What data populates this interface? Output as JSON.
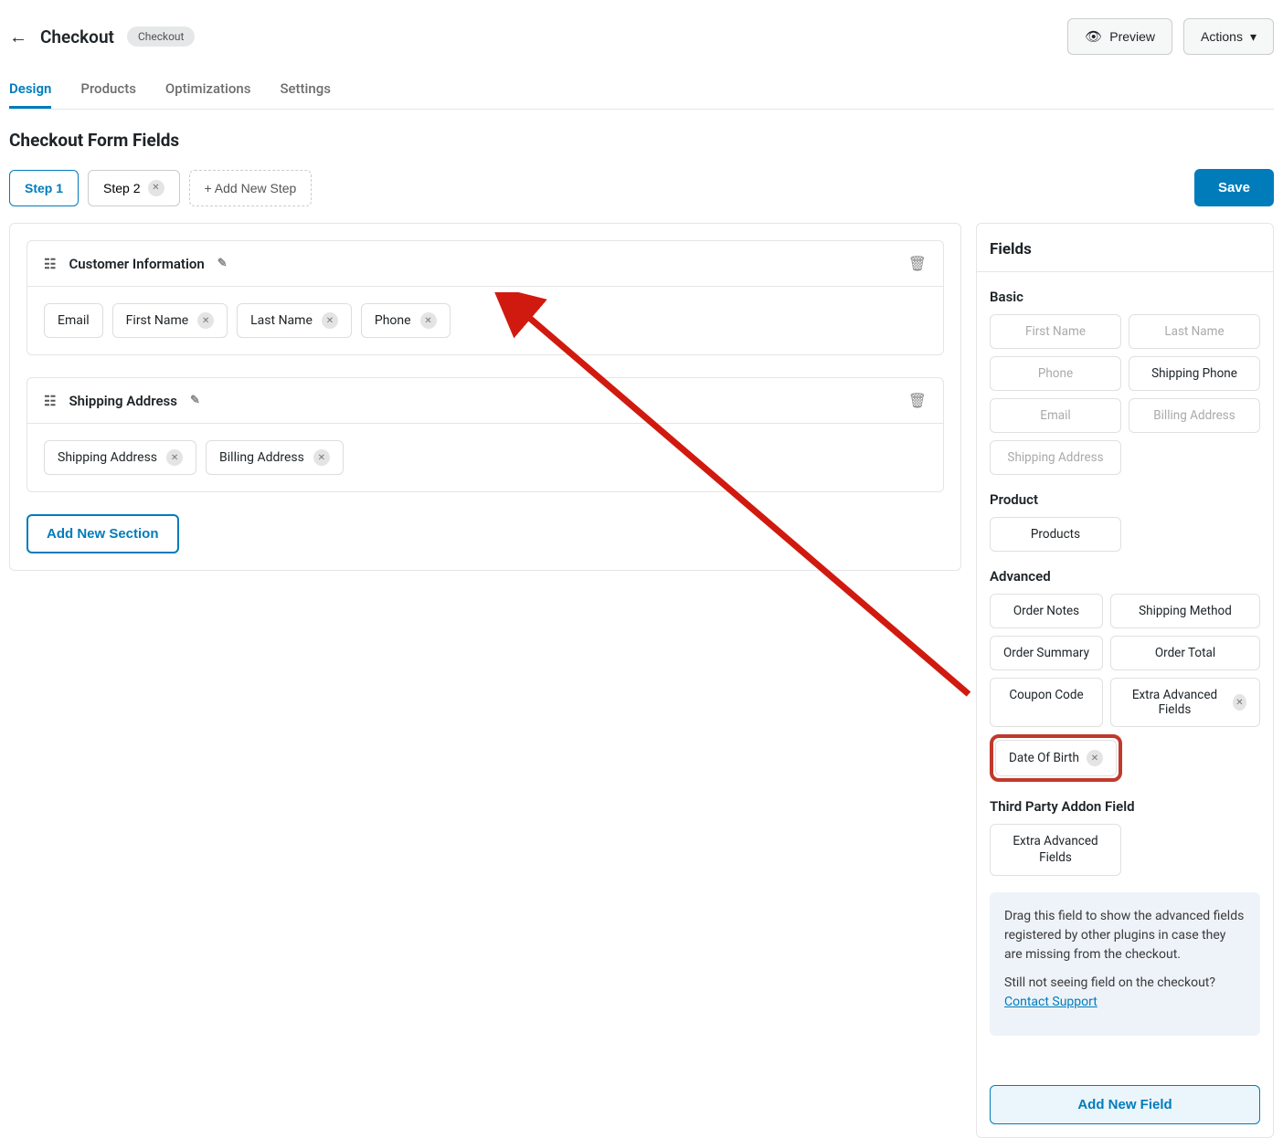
{
  "header": {
    "title": "Checkout",
    "badge": "Checkout",
    "preview": "Preview",
    "actions": "Actions"
  },
  "tabs": [
    "Design",
    "Products",
    "Optimizations",
    "Settings"
  ],
  "section_title": "Checkout Form Fields",
  "steps": {
    "step1": "Step 1",
    "step2": "Step 2",
    "add": "+ Add New Step"
  },
  "save": "Save",
  "sections": [
    {
      "title": "Customer Information",
      "fields": [
        "Email",
        "First Name",
        "Last Name",
        "Phone"
      ]
    },
    {
      "title": "Shipping Address",
      "fields": [
        "Shipping Address",
        "Billing Address"
      ]
    }
  ],
  "add_section": "Add New Section",
  "right": {
    "heading": "Fields",
    "groups": {
      "basic": {
        "label": "Basic",
        "items": [
          {
            "label": "First Name",
            "enabled": false
          },
          {
            "label": "Last Name",
            "enabled": false
          },
          {
            "label": "Phone",
            "enabled": false
          },
          {
            "label": "Shipping Phone",
            "enabled": true
          },
          {
            "label": "Email",
            "enabled": false
          },
          {
            "label": "Billing Address",
            "enabled": false
          },
          {
            "label": "Shipping Address",
            "enabled": false
          }
        ]
      },
      "product": {
        "label": "Product",
        "items": [
          {
            "label": "Products",
            "enabled": true
          }
        ]
      },
      "advanced": {
        "label": "Advanced",
        "items": [
          {
            "label": "Order Notes",
            "enabled": true
          },
          {
            "label": "Shipping Method",
            "enabled": true
          },
          {
            "label": "Order Summary",
            "enabled": true
          },
          {
            "label": "Order Total",
            "enabled": true
          },
          {
            "label": "Coupon Code",
            "enabled": true
          },
          {
            "label": "Extra Advanced Fields",
            "enabled": true,
            "x": true
          },
          {
            "label": "Date Of Birth",
            "enabled": true,
            "x": true,
            "highlight": true
          }
        ]
      },
      "third_party": {
        "label": "Third Party Addon Field",
        "items": [
          {
            "label": "Extra Advanced Fields",
            "enabled": true
          }
        ]
      }
    },
    "help": {
      "p1": "Drag this field to show the advanced fields registered by other plugins in case they are missing from the checkout.",
      "p2": "Still not seeing field on the checkout? ",
      "link": "Contact Support"
    },
    "add_field": "Add New Field"
  }
}
